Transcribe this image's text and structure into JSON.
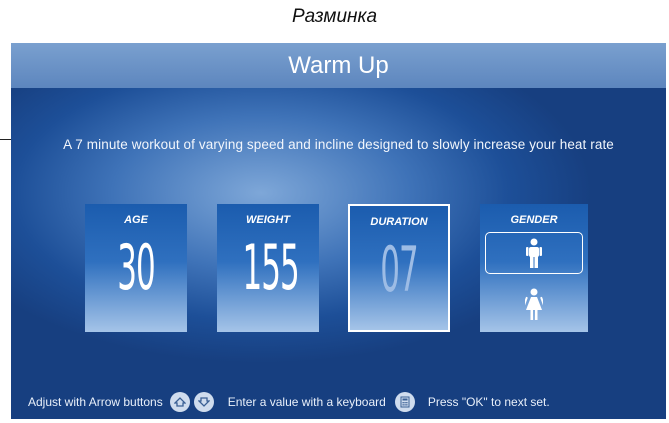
{
  "caption": "Разминка",
  "window": {
    "title": "Warm Up"
  },
  "description": "A 7 minute workout of varying speed and incline designed to slowly increase your heat rate",
  "cards": [
    {
      "label": "AGE",
      "value": "30"
    },
    {
      "label": "WEIGHT",
      "value": "155"
    },
    {
      "label": "DURATION",
      "value": "07"
    },
    {
      "label": "GENDER",
      "options": [
        "male-icon",
        "female-icon"
      ],
      "selected": "male"
    }
  ],
  "footer": {
    "adjust_text": "Adjust with Arrow buttons",
    "keyboard_text": "Enter a value with a keyboard",
    "ok_text": "Press \"OK\" to next set.",
    "icons": [
      "arrow-up-icon",
      "arrow-down-icon",
      "keyboard-icon"
    ]
  },
  "colors": {
    "panel": "#1d4f98",
    "titlebar": "#6990c6",
    "card": "#2f70bf",
    "text": "#ffffff"
  }
}
